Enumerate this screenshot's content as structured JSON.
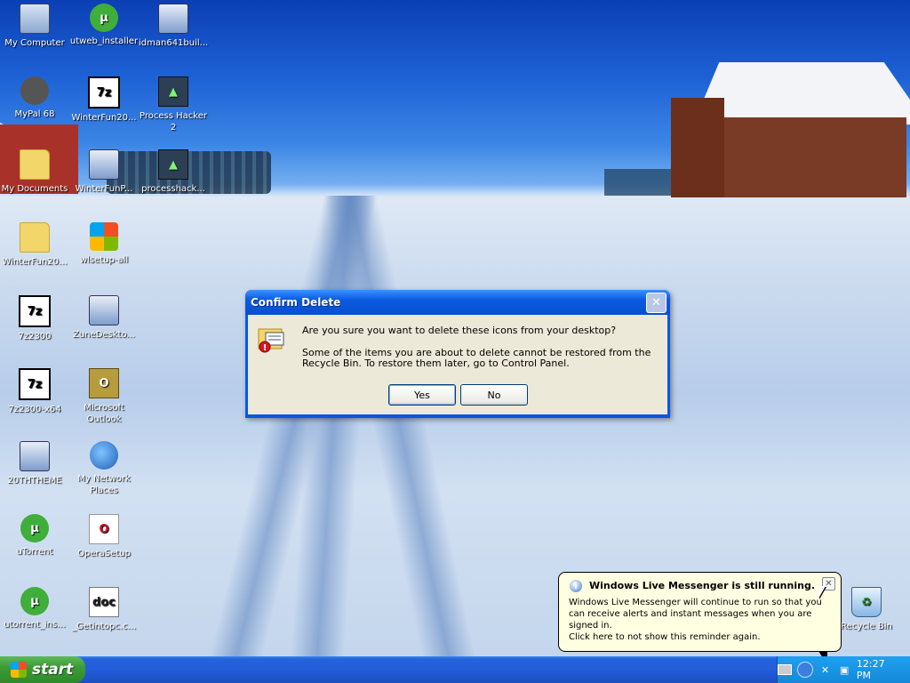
{
  "desktop": {
    "icons": [
      {
        "label": "My Computer",
        "glyph": "",
        "icon": "my-computer-icon"
      },
      {
        "label": "utweb_installer",
        "glyph": "µ",
        "icon": "utorrent-web-icon"
      },
      {
        "label": "idman641buil...",
        "glyph": "",
        "icon": "installer-icon"
      },
      {
        "label": "MyPal 68",
        "glyph": "",
        "icon": "mypal-icon"
      },
      {
        "label": "WinterFun20...",
        "glyph": "7z",
        "icon": "7zip-archive-icon"
      },
      {
        "label": "Process Hacker 2",
        "glyph": "▲",
        "icon": "process-hacker-icon"
      },
      {
        "label": "My Documents",
        "glyph": "",
        "icon": "my-documents-icon"
      },
      {
        "label": "WinterFunP...",
        "glyph": "",
        "icon": "installer-icon"
      },
      {
        "label": "processhack...",
        "glyph": "▲",
        "icon": "process-hacker-installer-icon"
      },
      {
        "label": "WinterFun20...",
        "glyph": "",
        "icon": "folder-icon"
      },
      {
        "label": "wlsetup-all",
        "glyph": "",
        "icon": "windows-setup-icon"
      },
      {
        "label": "7z2300",
        "glyph": "7z",
        "icon": "7zip-icon"
      },
      {
        "label": "ZuneDeskto...",
        "glyph": "",
        "icon": "installer-icon"
      },
      {
        "label": "7z2300-x64",
        "glyph": "7z",
        "icon": "7zip-icon"
      },
      {
        "label": "Microsoft Outlook",
        "glyph": "O",
        "icon": "outlook-icon"
      },
      {
        "label": "20THTHEME",
        "glyph": "",
        "icon": "installer-icon"
      },
      {
        "label": "My Network Places",
        "glyph": "",
        "icon": "network-places-icon"
      },
      {
        "label": "uTorrent",
        "glyph": "µ",
        "icon": "utorrent-icon"
      },
      {
        "label": "OperaSetup",
        "glyph": "O",
        "icon": "opera-icon"
      },
      {
        "label": "utorrent_ins...",
        "glyph": "µ",
        "icon": "utorrent-installer-icon"
      },
      {
        "label": "_Getintopc.c...",
        "glyph": "doc",
        "icon": "document-icon"
      },
      {
        "label": "Recycle Bin",
        "glyph": "♻",
        "icon": "recycle-bin-icon"
      }
    ]
  },
  "dialog": {
    "title": "Confirm Delete",
    "question": "Are you sure you want to delete these icons from your desktop?",
    "detail": "Some of the items you are about to delete cannot be restored from the Recycle Bin. To restore them later, go to Control Panel.",
    "yes_label": "Yes",
    "no_label": "No",
    "close_glyph": "✕"
  },
  "balloon": {
    "title": "Windows Live Messenger is still running.",
    "text": "Windows Live Messenger will continue to run so that you can receive alerts and instant messages when you are signed in.",
    "link": "Click here to not show this reminder again.",
    "close_glyph": "✕",
    "info_glyph": "i"
  },
  "taskbar": {
    "start_label": "start",
    "clock": "12:27 PM"
  },
  "colors": {
    "titlebar": "#0a58e0",
    "taskbar": "#245edb",
    "start": "#3c9c38",
    "balloon": "#ffffe1",
    "dialog_body": "#ece9d8"
  }
}
